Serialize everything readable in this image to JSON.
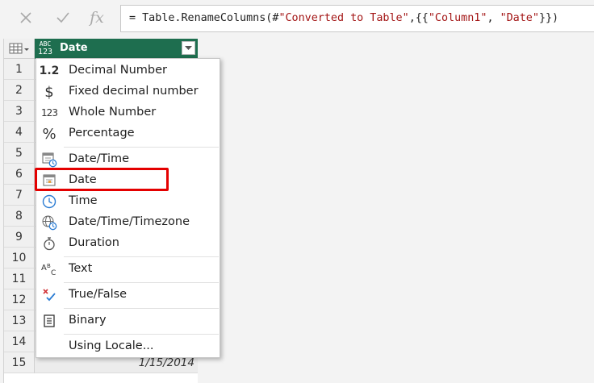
{
  "formula_bar": {
    "cancel_icon": "cross-icon",
    "commit_icon": "check-icon",
    "fx_label": "fx",
    "formula_prefix": "= Table.RenameColumns(#",
    "formula_str1": "\"Converted to Table\"",
    "formula_mid": ",{{",
    "formula_str2": "\"Column1\"",
    "formula_sep": ", ",
    "formula_str3": "\"Date\"",
    "formula_suffix": "}})"
  },
  "grid": {
    "column": {
      "type_icon_top": "ABC",
      "type_icon_bottom": "123",
      "name": "Date",
      "dropdown_icon": "chevron-down-icon"
    },
    "row_numbers": [
      "1",
      "2",
      "3",
      "4",
      "5",
      "6",
      "7",
      "8",
      "9",
      "10",
      "11",
      "12",
      "13",
      "14",
      "15"
    ],
    "visible_cell_value": "1/15/2014"
  },
  "type_menu": {
    "items": [
      {
        "icon": "1.2",
        "label": "Decimal Number"
      },
      {
        "icon": "$",
        "label": "Fixed decimal number"
      },
      {
        "icon": "123",
        "label": "Whole Number"
      },
      {
        "icon": "%",
        "label": "Percentage"
      },
      {
        "icon": "datetime-icon",
        "label": "Date/Time"
      },
      {
        "icon": "calendar-icon",
        "label": "Date"
      },
      {
        "icon": "clock-icon",
        "label": "Time"
      },
      {
        "icon": "globe-clock-icon",
        "label": "Date/Time/Timezone"
      },
      {
        "icon": "stopwatch-icon",
        "label": "Duration"
      },
      {
        "icon": "text-abc-icon",
        "label": "Text"
      },
      {
        "icon": "true-false-icon",
        "label": "True/False"
      },
      {
        "icon": "binary-icon",
        "label": "Binary"
      },
      {
        "icon": "",
        "label": "Using Locale..."
      }
    ],
    "highlighted_item": "Date",
    "highlight_color": "#e40000"
  },
  "colors": {
    "header_green": "#1e6e4f"
  }
}
